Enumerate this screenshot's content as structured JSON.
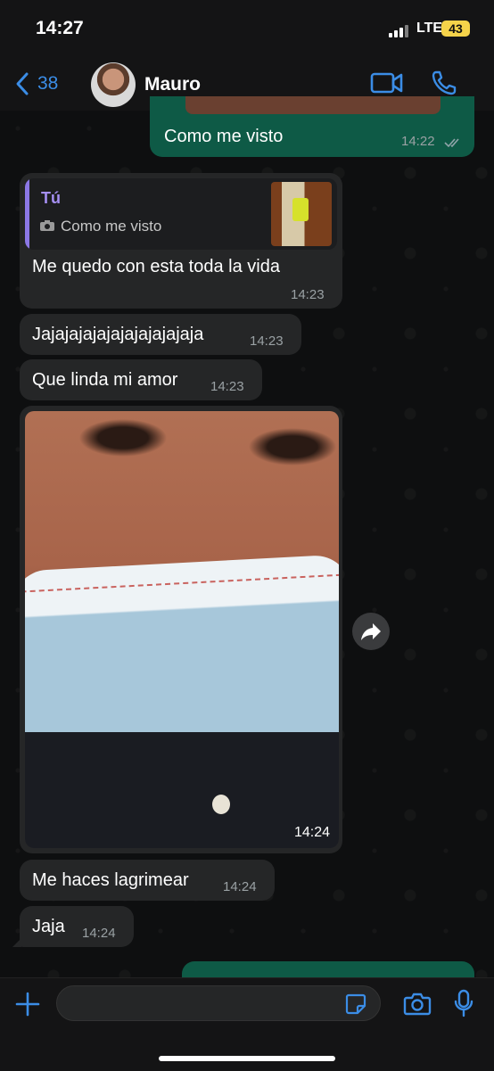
{
  "status_bar": {
    "time": "14:27",
    "network": "LTE",
    "battery": "43"
  },
  "header": {
    "back_count": "38",
    "contact_name": "Mauro",
    "icons": [
      "back-chevron-icon",
      "video-call-icon",
      "phone-icon"
    ]
  },
  "messages": [
    {
      "type": "out",
      "text": "Como me visto",
      "time": "14:22",
      "status": "read"
    },
    {
      "type": "in",
      "text": "Me quedo con esta toda la vida",
      "time": "14:23",
      "quote": {
        "author": "Tú",
        "text": "Como me visto"
      }
    },
    {
      "type": "in",
      "text": "Jajajajajajajajajajajaja",
      "time": "14:23"
    },
    {
      "type": "in",
      "text": "Que linda mi amor",
      "time": "14:23"
    },
    {
      "type": "in-photo",
      "time": "14:24"
    },
    {
      "type": "in",
      "text": "Me haces lagrimear",
      "time": "14:24"
    },
    {
      "type": "in",
      "text": "Jaja",
      "time": "14:24"
    }
  ],
  "input": {
    "placeholder": ""
  },
  "colors": {
    "accent": "#3b8de6",
    "outgoing": "#0e5a46",
    "incoming": "#252627",
    "quote_author": "#a58ff2"
  }
}
